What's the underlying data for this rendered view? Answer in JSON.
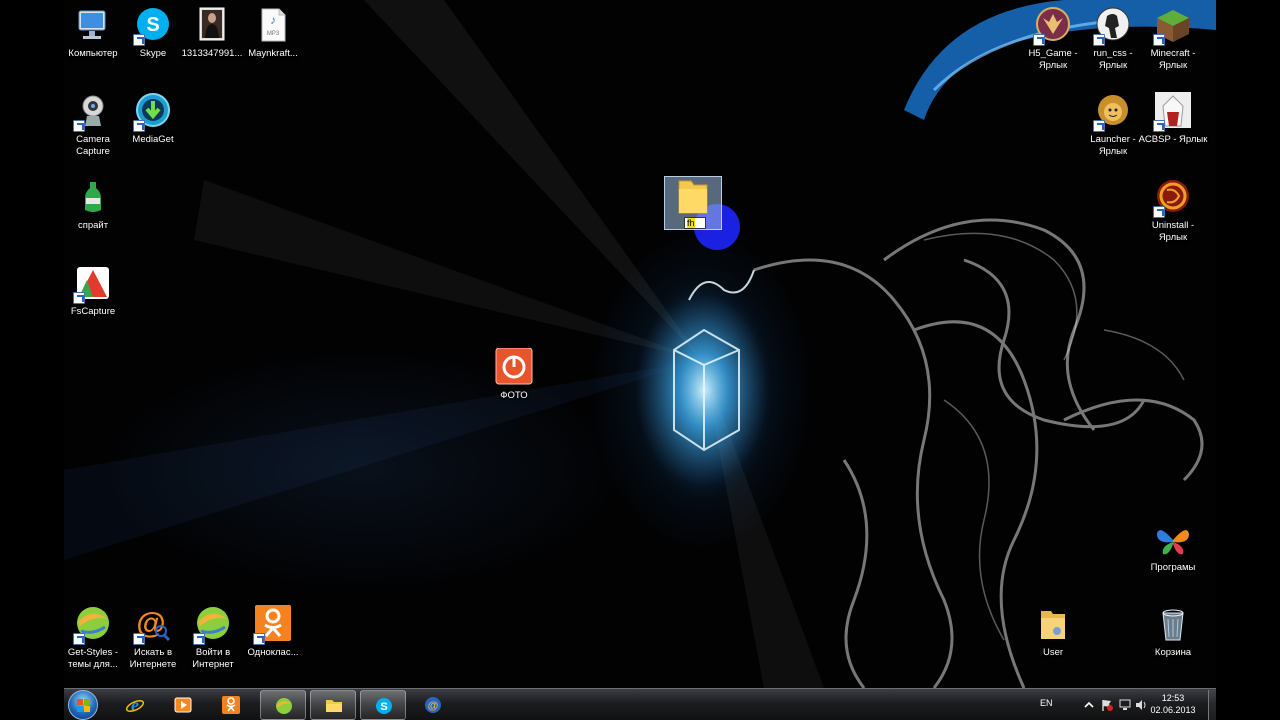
{
  "desktop_icons": {
    "computer": "Компьютер",
    "skype": "Skype",
    "photo_file": "1313347991...",
    "mp3_file": "Maynkraft...",
    "camera_capture": "Camera Capture",
    "mediaget": "MediaGet",
    "sprite": "спрайт",
    "fscapture": "FsCapture",
    "foto": "ФОТО",
    "h5_game": "H5_Game - Ярлык",
    "run_css": "run_css - Ярлык",
    "minecraft": "Minecraft - Ярлык",
    "launcher": "Launcher - Ярлык",
    "acbsp": "ACBSP - Ярлык",
    "uninstall": "Uninstall - Ярлык",
    "programs": "Програмы",
    "user": "User",
    "recycle_bin": "Корзина",
    "get_styles": "Get-Styles - темы для...",
    "search_internet": "Искать в Интернете",
    "login_internet": "Войти в Интернет",
    "odnoklassniki": "Одноклас..."
  },
  "rename": {
    "value": "fh"
  },
  "taskbar": {
    "language": "EN",
    "time": "12:53",
    "date": "02.06.2013"
  },
  "colors": {
    "taskbar_top": "#3b3d42",
    "desktop_bg": "#020203",
    "drag_highlight": "#1a21e0",
    "ok_orange": "#f58220"
  }
}
